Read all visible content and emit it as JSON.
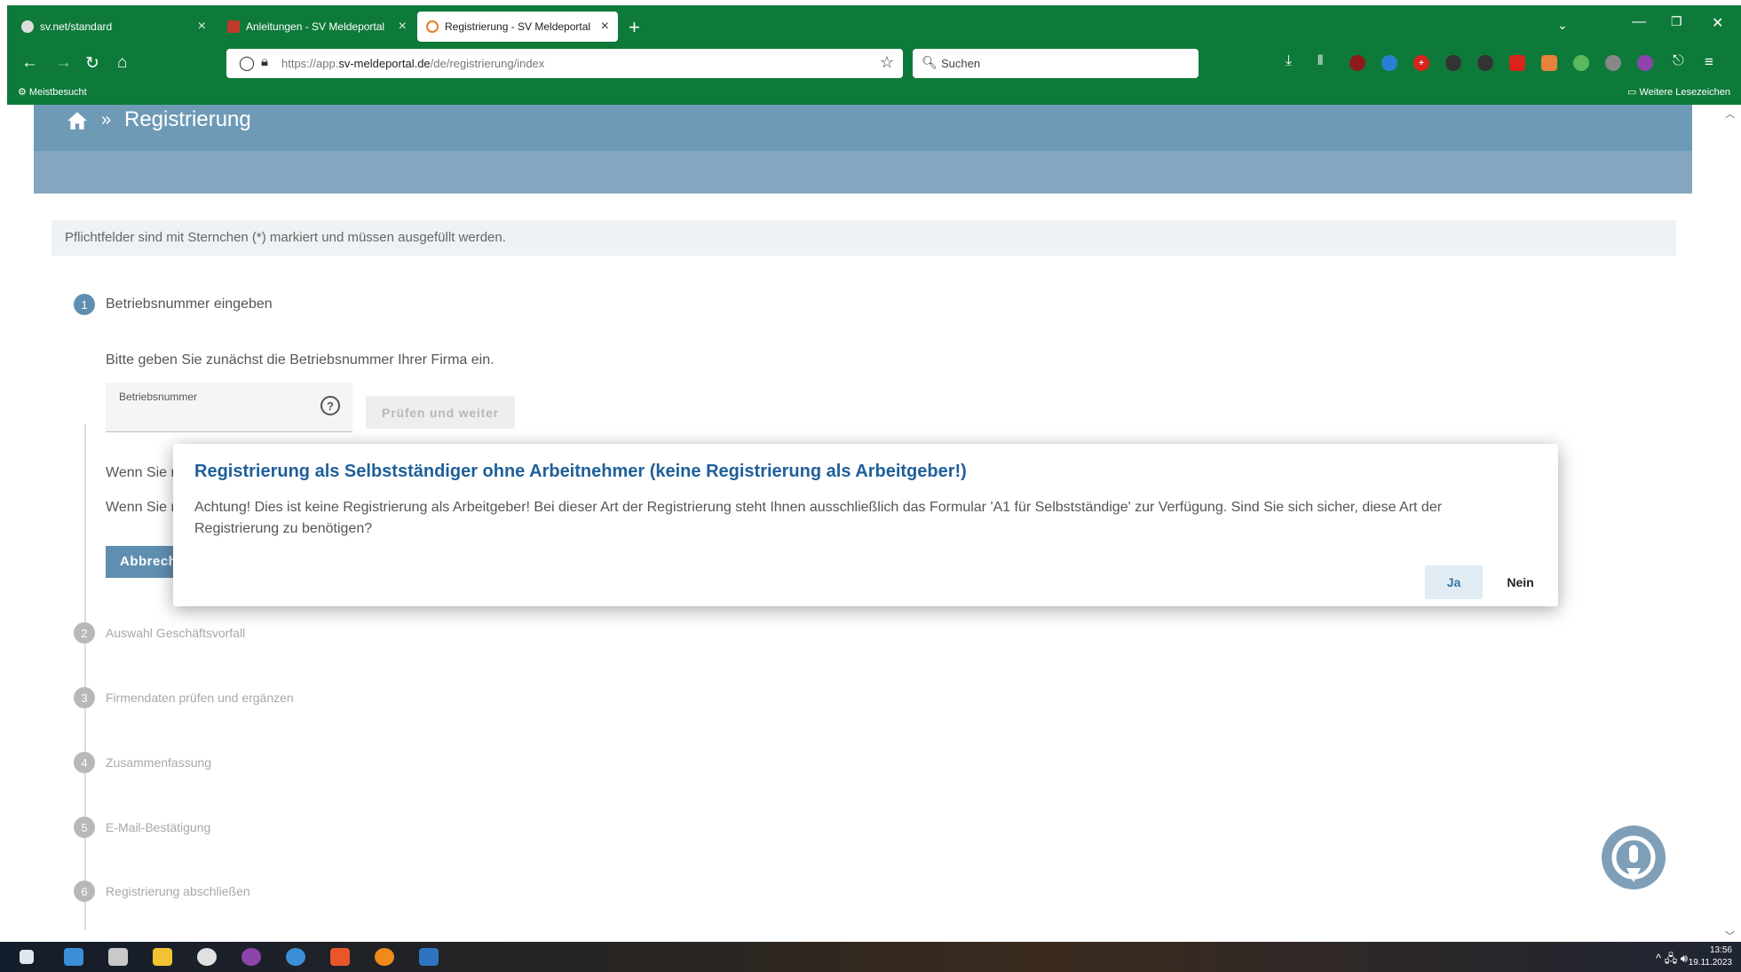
{
  "browser": {
    "tabs": [
      {
        "title": "sv.net/standard",
        "active": false,
        "favicon_color": "#dddddd"
      },
      {
        "title": "Anleitungen - SV Meldeportal",
        "active": false,
        "favicon_color": "#c0392b"
      },
      {
        "title": "Registrierung - SV Meldeportal",
        "active": true,
        "favicon_color": "#e67e22"
      }
    ],
    "url_prefix": "https://app.",
    "url_domain": "sv-meldeportal.de",
    "url_path": "/de/registrierung/index",
    "search_placeholder": "Suchen",
    "bookmarks_left": "Meistbesucht",
    "bookmarks_right": "Weitere Lesezeichen"
  },
  "breadcrumb": {
    "separator": "»",
    "title": "Registrierung"
  },
  "form": {
    "mandatory_note": "Pflichtfelder sind mit Sternchen (*) markiert und müssen ausgefüllt werden.",
    "intro": "Bitte geben Sie zunächst die Betriebsnummer Ihrer Firma ein.",
    "betriebsnummer_label": "Betriebsnummer",
    "check_button": "Prüfen und weiter",
    "wenn1": "Wenn Sie r",
    "wenn2": "Wenn Sie r",
    "cancel_button": "Abbrechen"
  },
  "steps": [
    {
      "num": "1",
      "label": "Betriebsnummer eingeben"
    },
    {
      "num": "2",
      "label": "Auswahl Geschäftsvorfall"
    },
    {
      "num": "3",
      "label": "Firmendaten prüfen und ergänzen"
    },
    {
      "num": "4",
      "label": "Zusammenfassung"
    },
    {
      "num": "5",
      "label": "E-Mail-Bestätigung"
    },
    {
      "num": "6",
      "label": "Registrierung abschließen"
    }
  ],
  "dialog": {
    "title": "Registrierung als Selbstständiger ohne Arbeitnehmer (keine Registrierung als Arbeitgeber!)",
    "text": "Achtung! Dies ist keine Registrierung als Arbeitgeber! Bei dieser Art der Registrierung steht Ihnen ausschließlich das Formular 'A1 für Selbstständige' zur Verfügung. Sind Sie sich sicher, diese Art der Registrierung zu benötigen?",
    "yes": "Ja",
    "no": "Nein"
  },
  "taskbar": {
    "time": "13:56",
    "date": "19.11.2023"
  },
  "colors": {
    "browser_chrome": "#0e7a3a",
    "header": "#6e9ab6",
    "accent": "#5f8fb0",
    "dialog_title": "#1f5f9a"
  }
}
